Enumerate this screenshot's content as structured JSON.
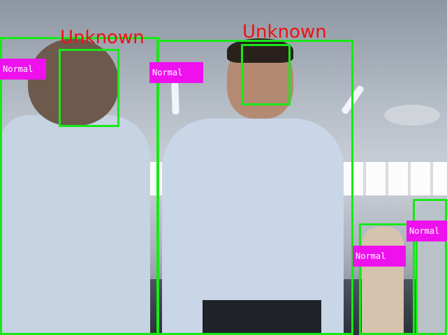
{
  "colors": {
    "box_green": "#18e818",
    "tag_magenta": "#ee11ee",
    "name_red": "#ee1111",
    "tag_text": "#ffffff"
  },
  "detections": {
    "left_person": {
      "status": "Normal"
    },
    "left_face": {
      "identity": "Unknown"
    },
    "center_person": {
      "status": "Normal"
    },
    "center_face": {
      "identity": "Unknown"
    },
    "right_person_1": {
      "status": "Normal"
    },
    "right_person_2": {
      "status": "Normal"
    }
  }
}
